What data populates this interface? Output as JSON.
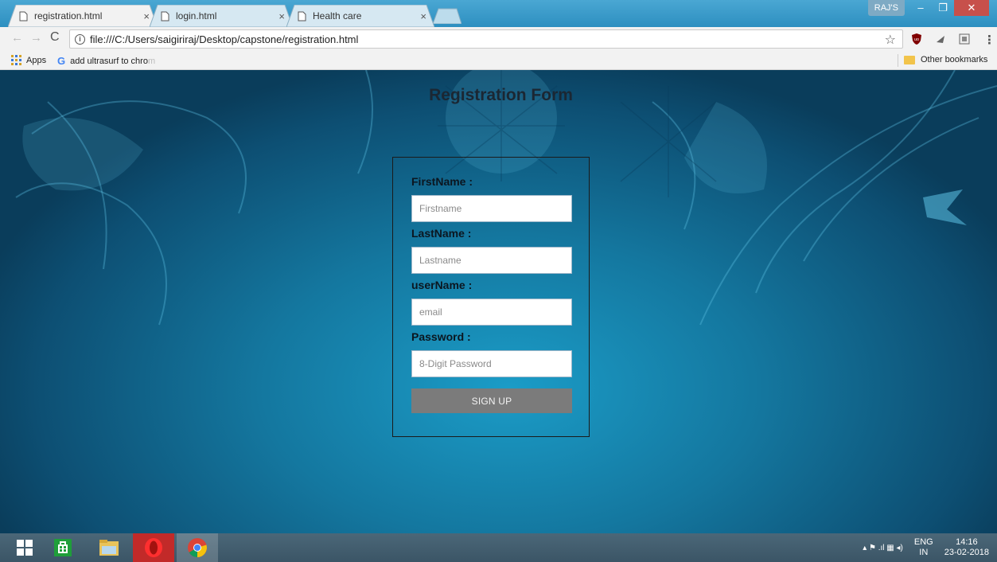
{
  "browser": {
    "tabs": [
      {
        "title": "registration.html",
        "active": true
      },
      {
        "title": "login.html",
        "active": false
      },
      {
        "title": "Health care",
        "active": false
      }
    ],
    "close_glyph": "×",
    "profile": "RAJ'S",
    "window_controls": {
      "minimize": "–",
      "restore": "❐",
      "close": "✕"
    },
    "nav": {
      "back": "←",
      "forward": "→",
      "reload": "C"
    },
    "info_glyph": "i",
    "url": "file:///C:/Users/saigiriraj/Desktop/capstone/registration.html",
    "star_glyph": "☆",
    "menu_glyph": "⋮",
    "bookmarks": {
      "apps_label": "Apps",
      "google_glyph": "G",
      "item_visible": "add ultrasurf to chro",
      "item_faded": "m",
      "other_label": "Other bookmarks"
    },
    "accent_color": "#2d8fc0"
  },
  "page": {
    "title": "Registration Form",
    "form": {
      "firstname_label": "FirstName :",
      "firstname_placeholder": "Firstname",
      "lastname_label": "LastName :",
      "lastname_placeholder": "Lastname",
      "username_label": "userName :",
      "username_placeholder": "email",
      "password_label": "Password :",
      "password_placeholder": "8-Digit Password",
      "submit_label": "SIGN UP"
    },
    "button_color": "#7b7b7b"
  },
  "taskbar": {
    "apps": [
      "windows-start-icon",
      "store-icon",
      "file-explorer-icon",
      "opera-icon",
      "chrome-icon"
    ],
    "tray_glyphs": "▴  ⚑  .ıl  ▦  ◂)",
    "lang_line1": "ENG",
    "lang_line2": "IN",
    "time": "14:16",
    "date": "23-02-2018"
  }
}
